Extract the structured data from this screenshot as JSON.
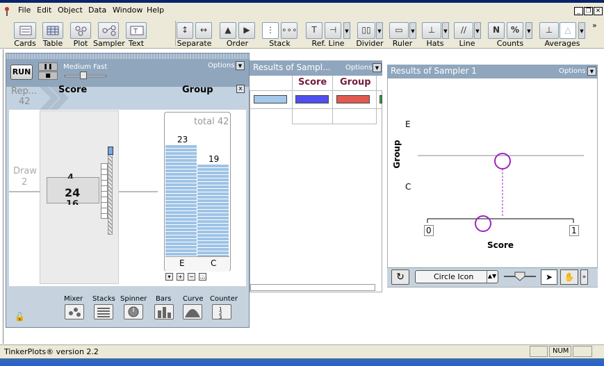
{
  "menubar": {
    "items": [
      "File",
      "Edit",
      "Object",
      "Data",
      "Window",
      "Help"
    ]
  },
  "toolbar": {
    "groups": [
      {
        "label": "Cards",
        "icon": "cards-icon"
      },
      {
        "label": "Table",
        "icon": "table-icon"
      },
      {
        "label": "Plot",
        "icon": "plot-icon"
      },
      {
        "label": "Sampler",
        "icon": "sampler-icon"
      },
      {
        "label": "Text",
        "icon": "text-icon"
      }
    ],
    "plot_groups": {
      "separate": "Separate",
      "order": "Order",
      "stack": "Stack",
      "ref_line": "Ref. Line",
      "divider": "Divider",
      "ruler": "Ruler",
      "hats": "Hats",
      "line": "Line",
      "counts": "Counts",
      "averages": "Averages"
    },
    "counts_n": "N",
    "counts_pct": "%",
    "more": "»"
  },
  "sampler": {
    "run_label": "RUN",
    "speed_label": "Medium Fast",
    "options_label": "Options",
    "repeat_label": "Rep...",
    "repeat_value": "42",
    "draw_label": "Draw",
    "draw_value": "2",
    "score_header": "Score",
    "group_header": "Group",
    "close": "x",
    "spinner": {
      "prev": "4",
      "current": "24",
      "next": "16"
    },
    "group_total": "total 42",
    "counts": {
      "E": "23",
      "C": "19"
    },
    "categories": [
      "E",
      "C"
    ],
    "palette": [
      "Mixer",
      "Stacks",
      "Spinner",
      "Bars",
      "Curve",
      "Counter"
    ],
    "colors": {
      "bars": "#9ec3e6",
      "panel": "#8fa6bd"
    }
  },
  "results_table": {
    "title": "Results of Sampl...",
    "options_label": "Options",
    "columns": [
      "Score",
      "Group"
    ],
    "swatch_colors": [
      "#a6c8ec",
      "#4f4ff0",
      "#e05a4f",
      "#33aa33"
    ]
  },
  "plot": {
    "title": "Results of Sampler 1",
    "options_label": "Options",
    "y_title": "Group",
    "y_categories": [
      "E",
      "C"
    ],
    "x_title": "Score",
    "x_min_label": "0",
    "x_max_label": "1",
    "icon_select": "Circle Icon",
    "marker_color": "#a020c0"
  },
  "status": {
    "text": "TinkerPlots® version 2.2",
    "num": "NUM"
  }
}
